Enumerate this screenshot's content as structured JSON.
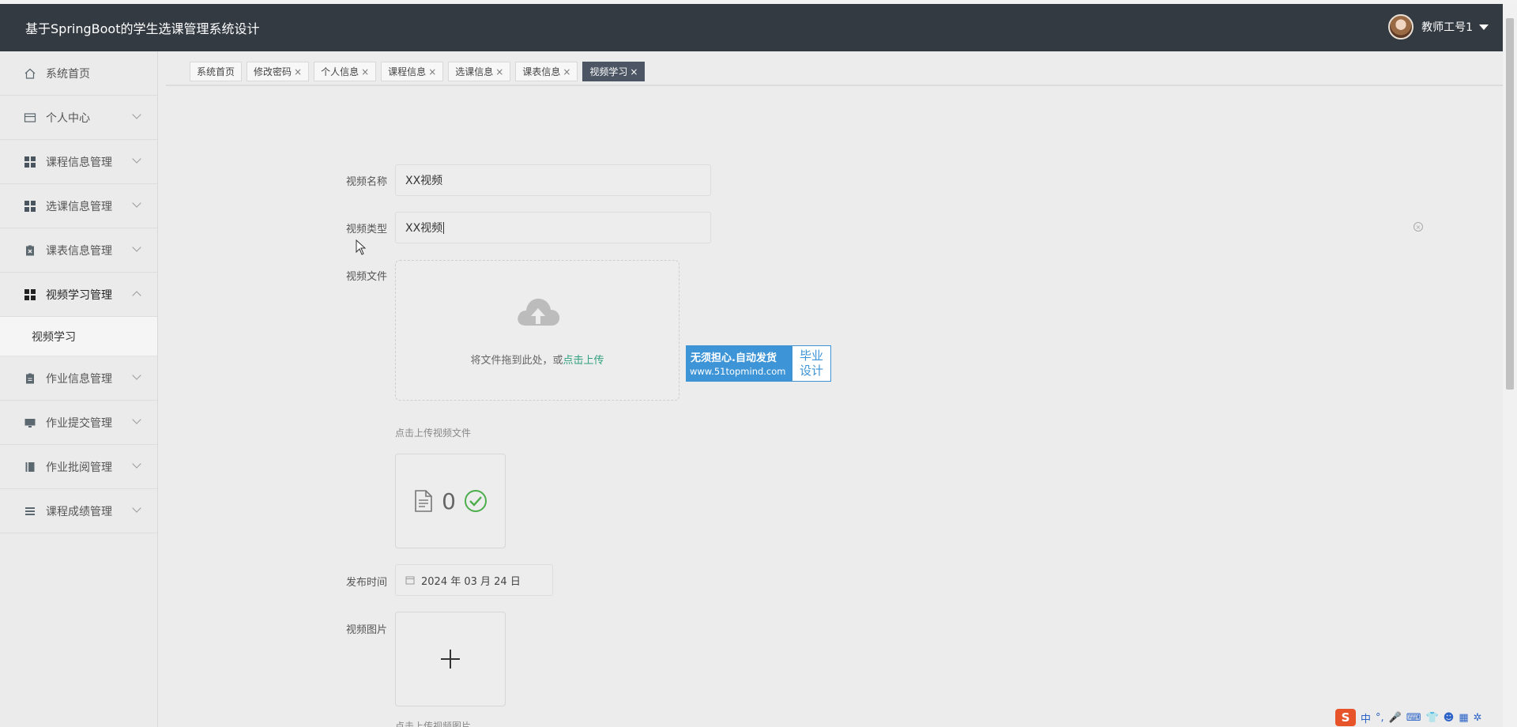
{
  "header": {
    "title": "基于SpringBoot的学生选课管理系统设计",
    "user_label": "教师工号1"
  },
  "sidebar": {
    "items": [
      {
        "label": "系统首页",
        "icon": "home-icon"
      },
      {
        "label": "个人中心",
        "icon": "card-icon"
      },
      {
        "label": "课程信息管理",
        "icon": "grid-icon"
      },
      {
        "label": "选课信息管理",
        "icon": "grid-icon"
      },
      {
        "label": "课表信息管理",
        "icon": "clipboard-x-icon"
      },
      {
        "label": "视频学习管理",
        "icon": "grid-icon"
      },
      {
        "label": "作业信息管理",
        "icon": "clipboard-icon"
      },
      {
        "label": "作业提交管理",
        "icon": "monitor-icon"
      },
      {
        "label": "作业批阅管理",
        "icon": "book-icon"
      },
      {
        "label": "课程成绩管理",
        "icon": "list-icon"
      }
    ],
    "sub_item": "视频学习"
  },
  "tabs": [
    {
      "label": "系统首页",
      "closable": false
    },
    {
      "label": "修改密码",
      "closable": true
    },
    {
      "label": "个人信息",
      "closable": true
    },
    {
      "label": "课程信息",
      "closable": true
    },
    {
      "label": "选课信息",
      "closable": true
    },
    {
      "label": "课表信息",
      "closable": true
    },
    {
      "label": "视频学习",
      "closable": true,
      "active": true
    }
  ],
  "tab_close": "×",
  "form": {
    "name_label": "视频名称",
    "name_value": "XX视频",
    "type_label": "视频类型",
    "type_value": "XX视频",
    "file_label": "视频文件",
    "upload_text": "将文件拖到此处，或",
    "upload_link": "点击上传",
    "file_hint": "点击上传视频文件",
    "file_count": "0",
    "time_label": "发布时间",
    "time_value": "2024 年 03 月 24 日",
    "image_label": "视频图片",
    "image_hint": "点击上传视频图片"
  },
  "banner": {
    "line1": "无须担心.自动发货",
    "line2": "www.51topmind.com",
    "right1": "毕业",
    "right2": "设计"
  },
  "ime": {
    "logo": "S",
    "lang": "中"
  },
  "colors": {
    "topbar": "#333a42",
    "active_tab": "#4b5563",
    "link_green": "#2fa07e",
    "banner_blue": "#3d94d6"
  }
}
